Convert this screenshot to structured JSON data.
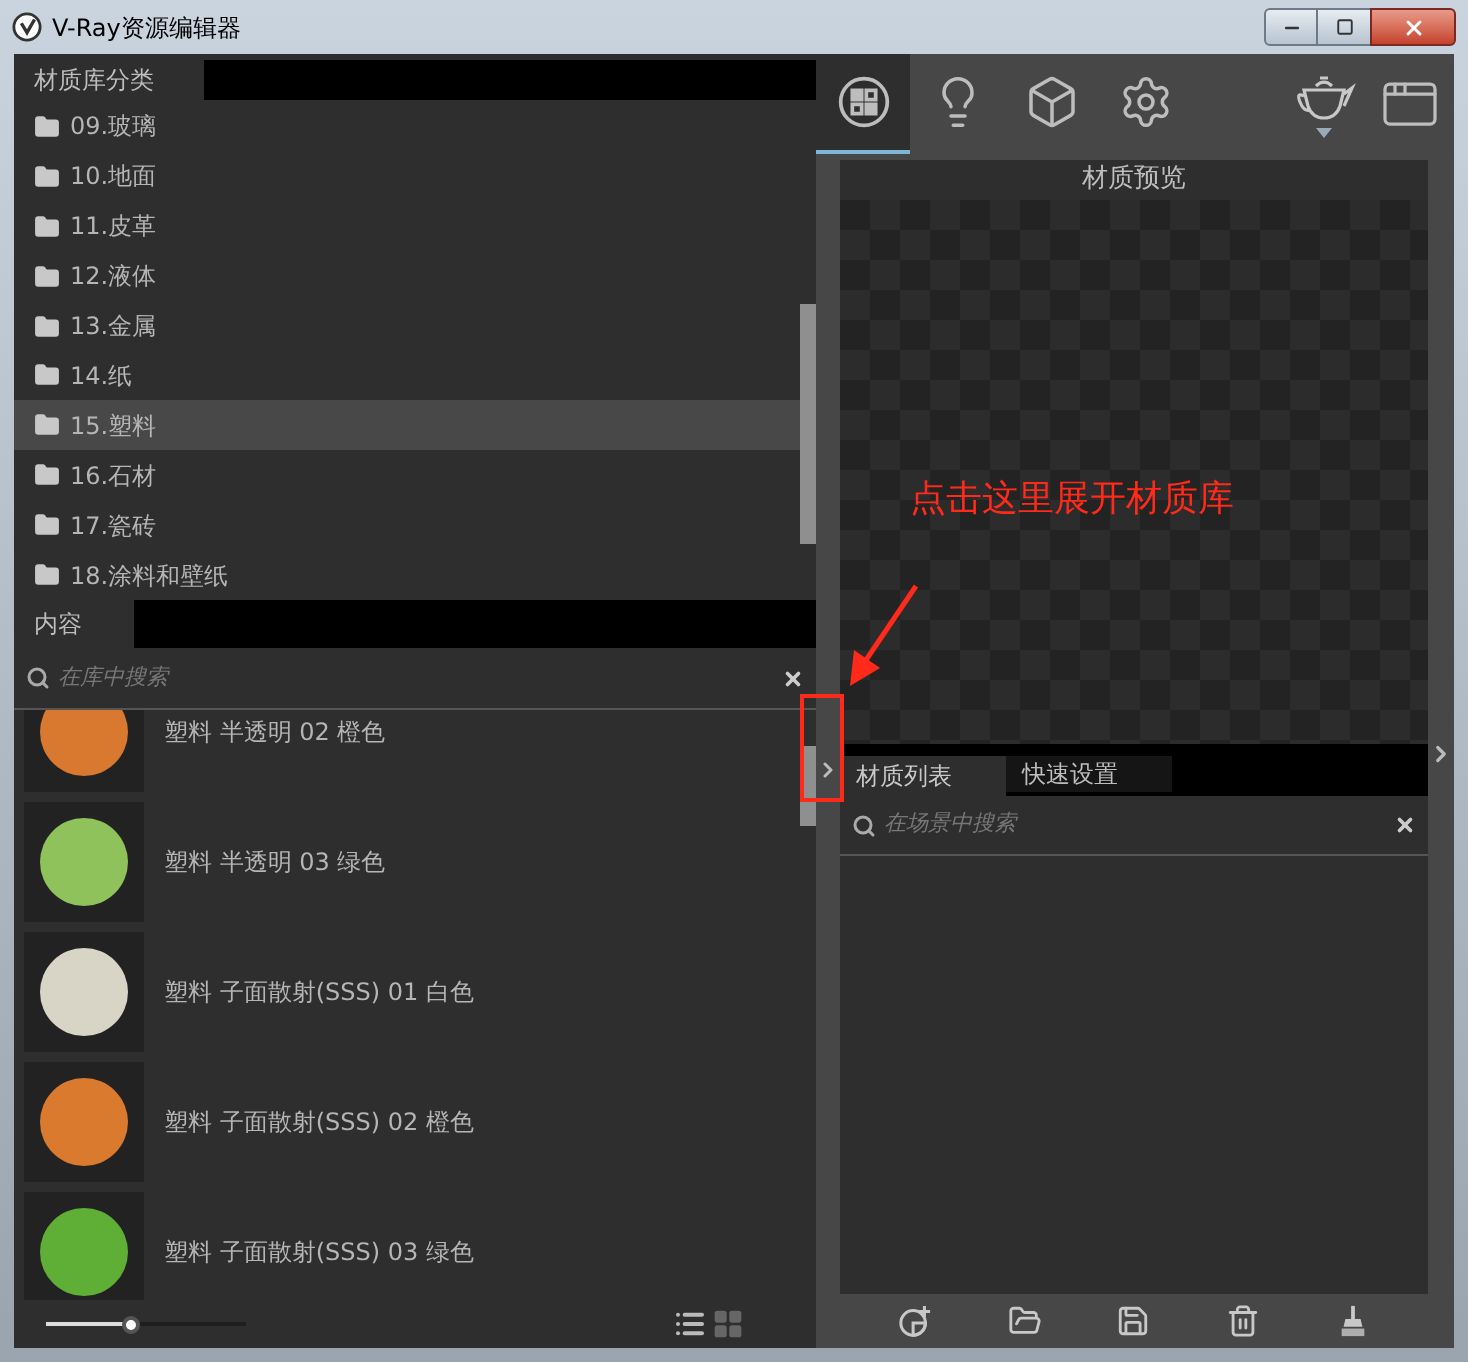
{
  "window": {
    "title": "V-Ray资源编辑器"
  },
  "library": {
    "header_tab": "材质库分类",
    "categories": [
      {
        "label": "09.玻璃",
        "selected": false
      },
      {
        "label": "10.地面",
        "selected": false
      },
      {
        "label": "11.皮革",
        "selected": false
      },
      {
        "label": "12.液体",
        "selected": false
      },
      {
        "label": "13.金属",
        "selected": false
      },
      {
        "label": "14.纸",
        "selected": false
      },
      {
        "label": "15.塑料",
        "selected": true
      },
      {
        "label": "16.石材",
        "selected": false
      },
      {
        "label": "17.瓷砖",
        "selected": false
      },
      {
        "label": "18.涂料和壁纸",
        "selected": false
      }
    ]
  },
  "content": {
    "header_tab": "内容",
    "search": {
      "placeholder": "在库中搜索"
    },
    "materials": [
      {
        "name": "塑料 半透明 02 橙色",
        "color": "#d9782f"
      },
      {
        "name": "塑料 半透明 03 绿色",
        "color": "#8fc25a"
      },
      {
        "name": "塑料 子面散射(SSS) 01 白色",
        "color": "#d8d4c6"
      },
      {
        "name": "塑料 子面散射(SSS) 02 橙色",
        "color": "#d97a2e"
      },
      {
        "name": "塑料 子面散射(SSS) 03 绿色",
        "color": "#5fae35"
      }
    ],
    "size_slider": {
      "level": 0.42
    },
    "view_modes": [
      {
        "kind": "list",
        "selected": true
      },
      {
        "kind": "grid",
        "selected": false
      }
    ]
  },
  "toolbar": {
    "tabs": [
      {
        "kind": "materials",
        "selected": true
      },
      {
        "kind": "lights",
        "selected": false
      },
      {
        "kind": "geometry",
        "selected": false
      },
      {
        "kind": "settings",
        "selected": false
      }
    ]
  },
  "preview": {
    "title": "材质预览"
  },
  "scene": {
    "tabs": [
      {
        "label": "材质列表",
        "selected": true
      },
      {
        "label": "快速设置",
        "selected": false
      }
    ],
    "search": {
      "placeholder": "在场景中搜索"
    }
  },
  "annotation": {
    "text": "点击这里展开材质库"
  }
}
